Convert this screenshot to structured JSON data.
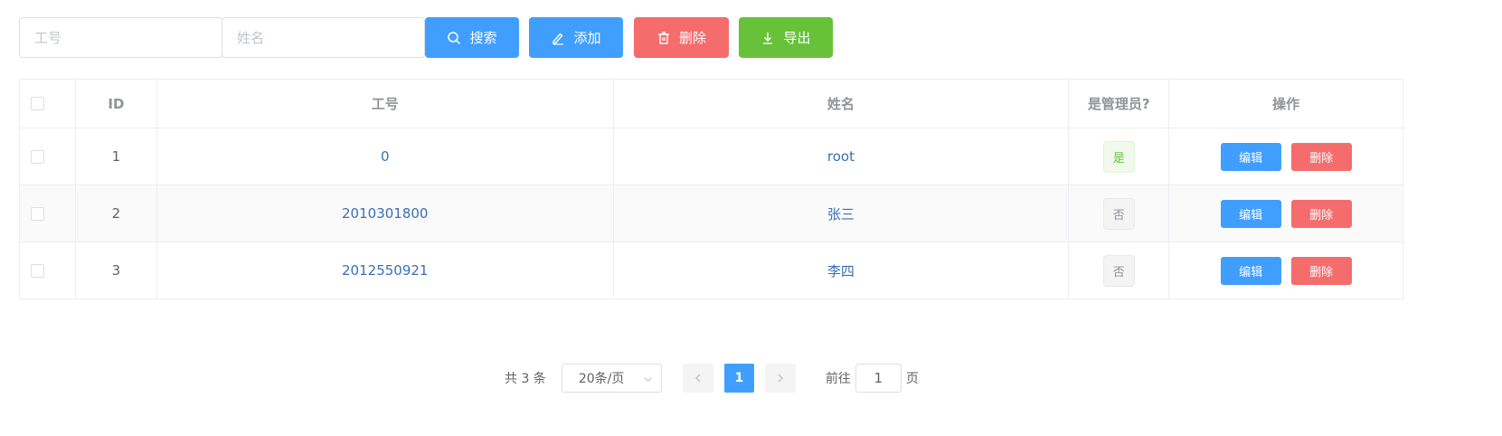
{
  "toolbar": {
    "job_no_placeholder": "工号",
    "name_placeholder": "姓名",
    "search_label": "搜索",
    "add_label": "添加",
    "delete_label": "删除",
    "export_label": "导出"
  },
  "table": {
    "headers": {
      "id": "ID",
      "job_no": "工号",
      "name": "姓名",
      "is_admin": "是管理员?",
      "actions": "操作"
    },
    "rows": [
      {
        "id": "1",
        "job_no": "0",
        "name": "root",
        "is_admin": "是",
        "edit": "编辑",
        "delete": "删除"
      },
      {
        "id": "2",
        "job_no": "2010301800",
        "name": "张三",
        "is_admin": "否",
        "edit": "编辑",
        "delete": "删除"
      },
      {
        "id": "3",
        "job_no": "2012550921",
        "name": "李四",
        "is_admin": "否",
        "edit": "编辑",
        "delete": "删除"
      }
    ]
  },
  "pager": {
    "total": "共 3 条",
    "page_size": "20条/页",
    "current_page": "1",
    "goto_prefix": "前往",
    "goto_value": "1",
    "goto_suffix": "页"
  }
}
